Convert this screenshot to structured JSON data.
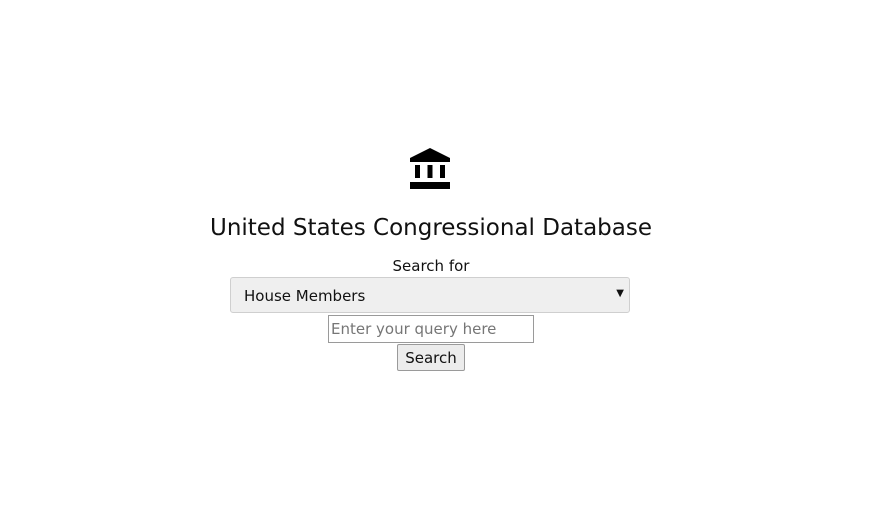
{
  "header": {
    "logo_icon": "bank-building-icon",
    "title": "United States Congressional Database"
  },
  "search": {
    "label": "Search for",
    "category_selected": "House Members",
    "input_value": "",
    "input_placeholder": "Enter your query here",
    "button_label": "Search"
  }
}
